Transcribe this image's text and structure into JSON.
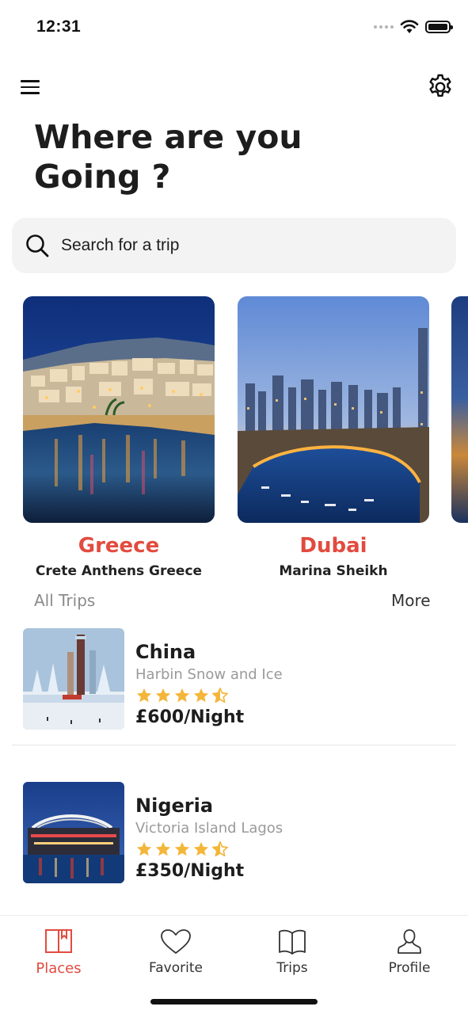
{
  "status_bar": {
    "time": "12:31"
  },
  "header": {
    "title": "Where are you Going ?"
  },
  "search": {
    "placeholder": "Search for a trip"
  },
  "featured": [
    {
      "name": "Greece",
      "subtitle": "Crete Anthens Greece"
    },
    {
      "name": "Dubai",
      "subtitle": "Marina Sheikh"
    }
  ],
  "all_trips": {
    "section_label": "All Trips",
    "more_label": "More",
    "items": [
      {
        "name": "China",
        "location": "Harbin Snow and Ice",
        "rating": 4.5,
        "price": "£600/Night"
      },
      {
        "name": "Nigeria",
        "location": "Victoria Island Lagos",
        "rating": 4.5,
        "price": "£350/Night"
      }
    ]
  },
  "tab_bar": {
    "tabs": [
      {
        "label": "Places",
        "icon": "book-icon",
        "active": true
      },
      {
        "label": "Favorite",
        "icon": "heart-icon",
        "active": false
      },
      {
        "label": "Trips",
        "icon": "open-book-icon",
        "active": false
      },
      {
        "label": "Profile",
        "icon": "user-icon",
        "active": false
      }
    ]
  },
  "colors": {
    "accent": "#e24b3f",
    "star": "#f4b63a",
    "search_bg": "#f3f3f3",
    "muted_text": "#9a9a9a"
  }
}
